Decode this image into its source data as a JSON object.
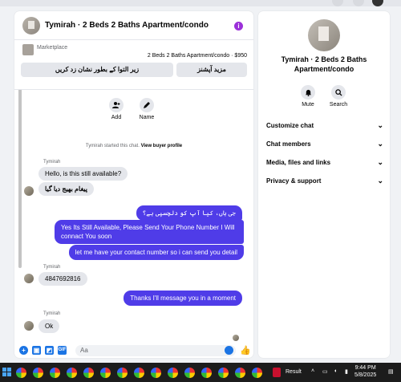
{
  "header": {
    "title": "Tymirah · 2 Beds 2 Baths Apartment/condo"
  },
  "marketplace": {
    "label": "Marketplace",
    "item": "2 Beds 2 Baths Apartment/condo · $950",
    "btn_left": "زیر التوا کے بطور نشان زد کریں",
    "btn_right": "مزید آپشنز"
  },
  "actions": {
    "add": "Add",
    "name": "Name"
  },
  "started": {
    "prefix": "Tymirah started this chat.",
    "link": "View buyer profile"
  },
  "messages": [
    {
      "sender": "Tymirah",
      "text": "Hello, is this still available?"
    },
    {
      "text": "پیغام بھیج دیا گیا"
    },
    {
      "text": "جی ہاں، کیا آپ کو دلچسپی ہے؟"
    },
    {
      "text": "Yes Its Still Available, Please Send Your Phone Number I Will connact You soon"
    },
    {
      "text": "let me have your contact number so i can send you detail"
    },
    {
      "sender": "Tymirah",
      "text": "4847692816"
    },
    {
      "text": "Thanks I'll message you in a moment"
    },
    {
      "sender": "Tymirah",
      "text": "Ok"
    }
  ],
  "composer": {
    "placeholder": "Aa"
  },
  "info": {
    "title_line1": "Tymirah · 2 Beds 2 Baths",
    "title_line2": "Apartment/condo",
    "mute": "Mute",
    "search": "Search",
    "rows": [
      "Customize chat",
      "Chat members",
      "Media, files and links",
      "Privacy & support"
    ]
  },
  "taskbar": {
    "search_text": "Result",
    "time": "9:44 PM",
    "date": "5/8/2025"
  },
  "colors": {
    "accent": "#4f3ce8",
    "brand": "#1b74e4",
    "info_icon": "#9b30d9"
  }
}
